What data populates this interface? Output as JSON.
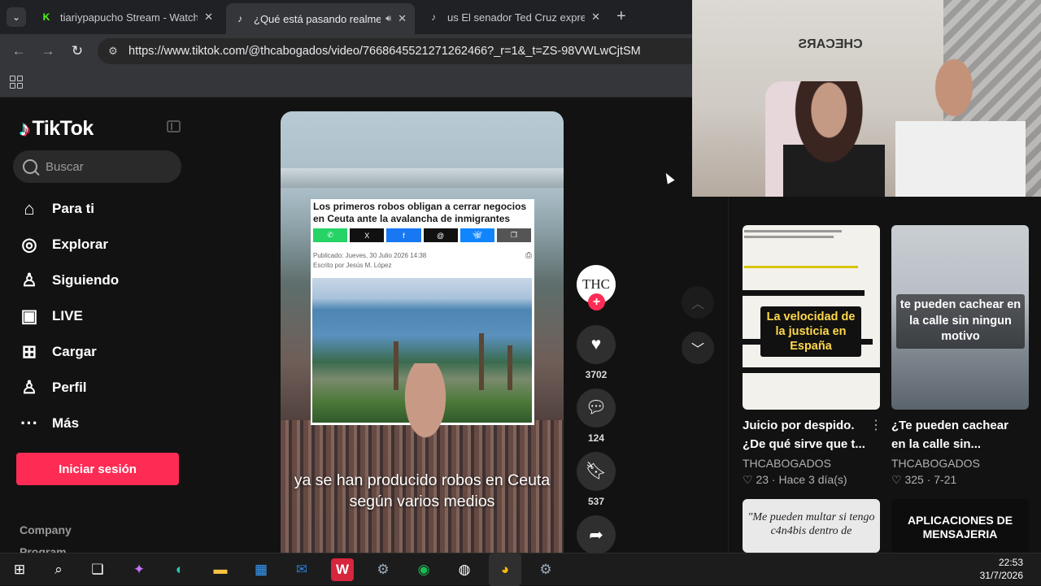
{
  "browser": {
    "tabs": [
      {
        "title": "tiariypapucho Stream - Watch L",
        "favicon": "kick-icon",
        "active": false
      },
      {
        "title": "¿Qué está pasando realmen",
        "favicon": "tiktok-icon",
        "active": true,
        "audio": true
      },
      {
        "title": "us El senador Ted Cruz expresó",
        "favicon": "tiktok-icon",
        "active": false
      }
    ],
    "url": "https://www.tiktok.com/@thcabogados/video/7668645521271262466?_r=1&_t=ZS-98VWLwCjtSM"
  },
  "tiktok": {
    "logo_text": "TikTok",
    "search_placeholder": "Buscar",
    "nav": [
      {
        "label": "Para ti",
        "icon": "home-icon"
      },
      {
        "label": "Explorar",
        "icon": "compass-icon"
      },
      {
        "label": "Siguiendo",
        "icon": "following-icon"
      },
      {
        "label": "LIVE",
        "icon": "live-icon"
      },
      {
        "label": "Cargar",
        "icon": "upload-icon"
      },
      {
        "label": "Perfil",
        "icon": "profile-icon"
      },
      {
        "label": "Más",
        "icon": "more-icon"
      }
    ],
    "login_label": "Iniciar sesión",
    "footer": [
      "Company",
      "Program"
    ],
    "brand_color": "#fe2c55"
  },
  "video": {
    "article_title": "Los primeros robos obligan a cerrar negocios en Ceuta ante la avalancha de inmigrantes",
    "share_buttons": [
      "whatsapp",
      "x",
      "facebook",
      "threads",
      "bluesky",
      "copy"
    ],
    "share_colors": [
      "#25d366",
      "#111111",
      "#1877f2",
      "#111111",
      "#1185fe",
      "#555555"
    ],
    "share_x_label": "X",
    "published": "Publicado: Jueves, 30 Julio 2026 14:38",
    "author_line": "Escrito por Jesús M. López",
    "caption": "ya se han producido robos en Ceuta según varios medios",
    "avatar_text": "THC",
    "likes": "3702",
    "comments": "124",
    "saves": "537"
  },
  "recommendations": [
    {
      "title": "Juicio por despido. ¿De qué sirve que t...",
      "author": "THCABOGADOS",
      "likes": "23",
      "date": "Hace 3 día(s)",
      "overlay": "La velocidad de la justicia en España"
    },
    {
      "title": "¿Te pueden cachear en la calle sin...",
      "author": "THCABOGADOS",
      "likes": "325",
      "date": "7-21",
      "overlay": "te pueden cachear en la calle sin ningun motivo"
    },
    {
      "overlay": "\"Me pueden multar si tengo c4n4bis dentro de"
    },
    {
      "overlay": "APLICACIONES DE MENSAJERIA"
    }
  ],
  "webcam": {
    "sign": "CHECARS"
  },
  "taskbar": {
    "time": "22:53",
    "date": "31/7/2026"
  }
}
